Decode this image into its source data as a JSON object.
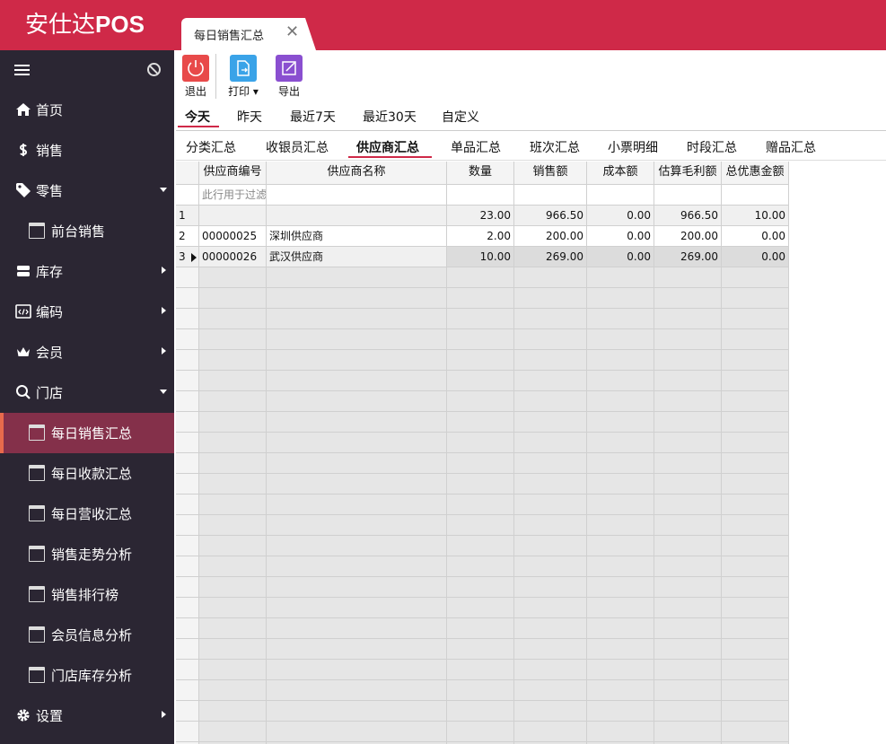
{
  "app": {
    "title_prefix": "安仕达",
    "title_suffix": "POS"
  },
  "tab": {
    "label": "每日销售汇总",
    "close": "✕"
  },
  "sidebar": {
    "items": [
      {
        "label": "首页",
        "icon": "home-icon"
      },
      {
        "label": "销售",
        "icon": "currency-icon"
      },
      {
        "label": "零售",
        "icon": "tag-icon"
      },
      {
        "label": "前台销售",
        "icon": "window-icon"
      },
      {
        "label": "库存",
        "icon": "storage-icon"
      },
      {
        "label": "编码",
        "icon": "code-icon"
      },
      {
        "label": "会员",
        "icon": "crown-icon"
      },
      {
        "label": "门店",
        "icon": "search-icon"
      },
      {
        "label": "每日销售汇总",
        "icon": "window-icon"
      },
      {
        "label": "每日收款汇总",
        "icon": "window-icon"
      },
      {
        "label": "每日营收汇总",
        "icon": "window-icon"
      },
      {
        "label": "销售走势分析",
        "icon": "window-icon"
      },
      {
        "label": "销售排行榜",
        "icon": "window-icon"
      },
      {
        "label": "会员信息分析",
        "icon": "window-icon"
      },
      {
        "label": "门店库存分析",
        "icon": "window-icon"
      },
      {
        "label": "设置",
        "icon": "gear-icon"
      }
    ]
  },
  "toolbar": {
    "exit": "退出",
    "print": "打印",
    "export": "导出"
  },
  "date_tabs": [
    "今天",
    "昨天",
    "最近7天",
    "最近30天",
    "自定义"
  ],
  "summary_tabs": [
    "分类汇总",
    "收银员汇总",
    "供应商汇总",
    "单品汇总",
    "班次汇总",
    "小票明细",
    "时段汇总",
    "赠品汇总"
  ],
  "grid": {
    "headers": [
      "供应商编号",
      "供应商名称",
      "数量",
      "销售额",
      "成本额",
      "估算毛利额",
      "总优惠金额"
    ],
    "filter_placeholder": "此行用于过滤",
    "rows": [
      {
        "no": "1",
        "code": "",
        "name": "",
        "qty": "23.00",
        "sales": "966.50",
        "cost": "0.00",
        "profit": "966.50",
        "discount": "10.00"
      },
      {
        "no": "2",
        "code": "00000025",
        "name": "深圳供应商",
        "qty": "2.00",
        "sales": "200.00",
        "cost": "0.00",
        "profit": "200.00",
        "discount": "0.00"
      },
      {
        "no": "3",
        "code": "00000026",
        "name": "武汉供应商",
        "qty": "10.00",
        "sales": "269.00",
        "cost": "0.00",
        "profit": "269.00",
        "discount": "0.00"
      }
    ]
  },
  "colors": {
    "brand": "#cf2948",
    "sidebar": "#2b2633",
    "active_item": "#84304a",
    "exit_button": "#e84a4a",
    "print_button": "#3aa3e8",
    "export_button": "#8a4fd0"
  }
}
